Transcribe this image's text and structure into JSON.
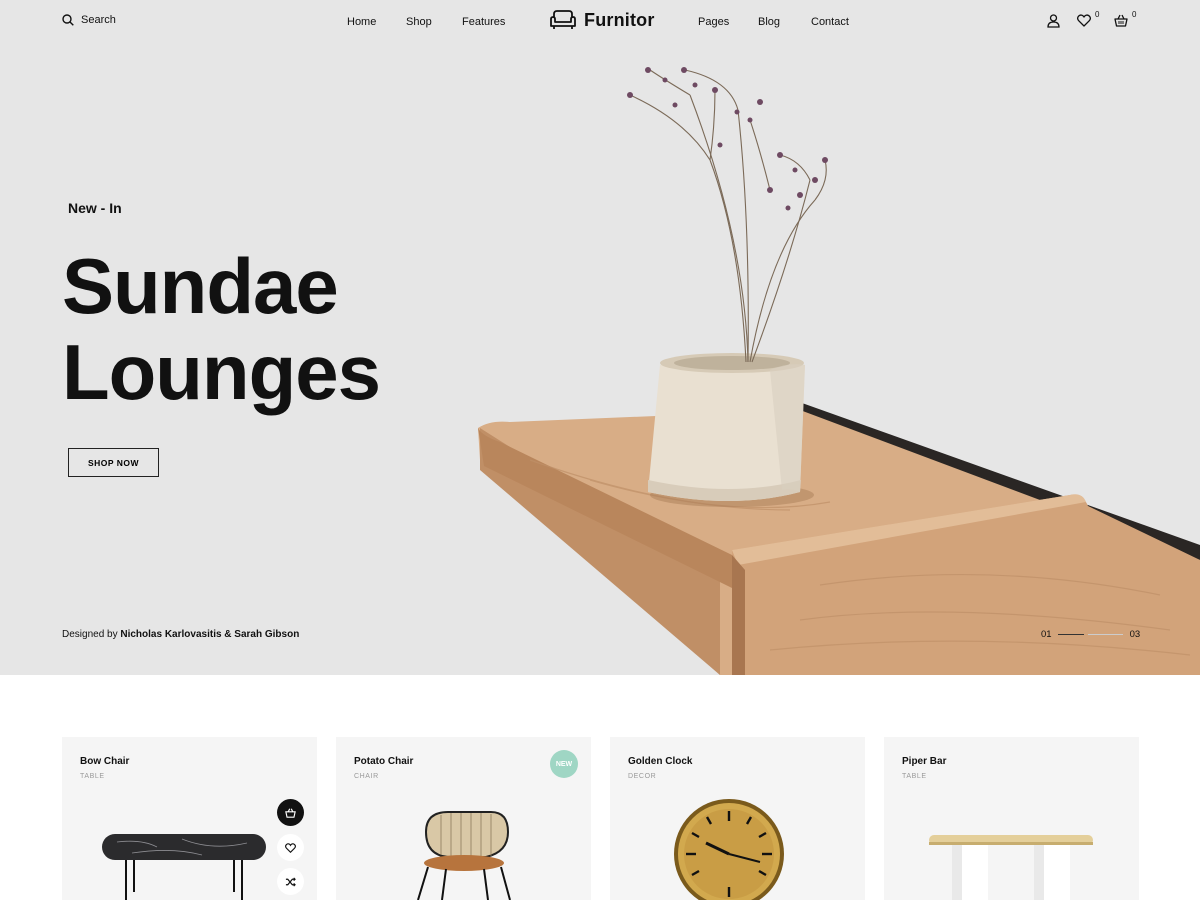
{
  "header": {
    "search_label": "Search",
    "nav": [
      "Home",
      "Shop",
      "Features",
      "Pages",
      "Blog",
      "Contact"
    ],
    "logo": "Furnitor",
    "wishlist_count": "0",
    "cart_count": "0"
  },
  "hero": {
    "eyebrow": "New - In",
    "title_line1": "Sundae",
    "title_line2": "Lounges",
    "cta": "SHOP NOW",
    "credit_prefix": "Designed by",
    "credit_names": "Nicholas Karlovasitis & Sarah Gibson",
    "slide_current": "01",
    "slide_total": "03"
  },
  "products": [
    {
      "name": "Bow Chair",
      "category": "TABLE"
    },
    {
      "name": "Potato Chair",
      "category": "CHAIR",
      "badge": "NEW"
    },
    {
      "name": "Golden Clock",
      "category": "DECOR"
    },
    {
      "name": "Piper Bar",
      "category": "TABLE"
    }
  ],
  "colors": {
    "hero_bg": "#e6e6e6",
    "card_bg": "#f5f5f5",
    "badge": "#9fd6c4",
    "wood": "#c9a27c"
  }
}
